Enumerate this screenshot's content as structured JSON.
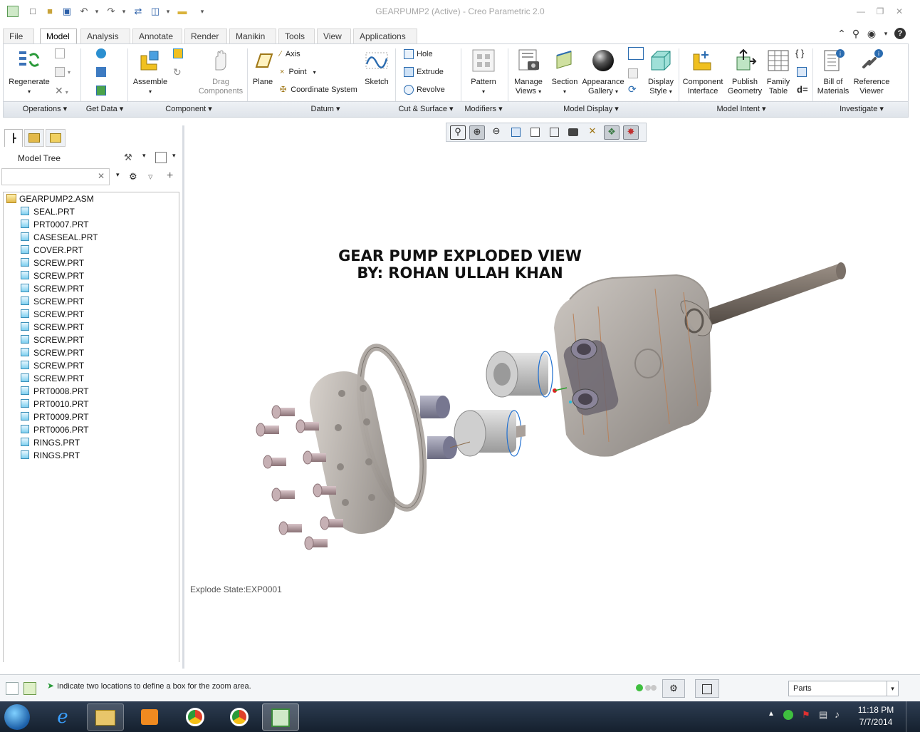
{
  "window": {
    "title": "GEARPUMP2 (Active) - Creo Parametric 2.0"
  },
  "tabs": [
    {
      "label": "File"
    },
    {
      "label": "Model"
    },
    {
      "label": "Analysis"
    },
    {
      "label": "Annotate"
    },
    {
      "label": "Render"
    },
    {
      "label": "Manikin"
    },
    {
      "label": "Tools"
    },
    {
      "label": "View"
    },
    {
      "label": "Applications"
    }
  ],
  "ribbon": {
    "regenerate": "Regenerate",
    "assemble": "Assemble",
    "drag_components_1": "Drag",
    "drag_components_2": "Components",
    "plane": "Plane",
    "axis": "Axis",
    "point": "Point",
    "coordinate_system": "Coordinate System",
    "sketch": "Sketch",
    "hole": "Hole",
    "extrude": "Extrude",
    "revolve": "Revolve",
    "pattern": "Pattern",
    "manage_views_1": "Manage",
    "manage_views_2": "Views",
    "section": "Section",
    "appearance_gallery_1": "Appearance",
    "appearance_gallery_2": "Gallery",
    "display_style_1": "Display",
    "display_style_2": "Style",
    "component_interface_1": "Component",
    "component_interface_2": "Interface",
    "publish_geometry_1": "Publish",
    "publish_geometry_2": "Geometry",
    "family_table_1": "Family",
    "family_table_2": "Table",
    "bill_of_materials_1": "Bill of",
    "bill_of_materials_2": "Materials",
    "reference_viewer_1": "Reference",
    "reference_viewer_2": "Viewer",
    "groups": {
      "operations": "Operations",
      "get_data": "Get Data",
      "component": "Component",
      "datum": "Datum",
      "cut_surface": "Cut & Surface",
      "modifiers": "Modifiers",
      "model_display": "Model Display",
      "model_intent": "Model Intent",
      "investigate": "Investigate"
    }
  },
  "model_tree": {
    "title": "Model Tree",
    "root": "GEARPUMP2.ASM",
    "items": [
      "SEAL.PRT",
      "PRT0007.PRT",
      "CASESEAL.PRT",
      "COVER.PRT",
      "SCREW.PRT",
      "SCREW.PRT",
      "SCREW.PRT",
      "SCREW.PRT",
      "SCREW.PRT",
      "SCREW.PRT",
      "SCREW.PRT",
      "SCREW.PRT",
      "SCREW.PRT",
      "SCREW.PRT",
      "PRT0008.PRT",
      "PRT0010.PRT",
      "PRT0009.PRT",
      "PRT0006.PRT",
      "RINGS.PRT",
      "RINGS.PRT"
    ]
  },
  "canvas": {
    "title_line1": "GEAR PUMP EXPLODED VIEW",
    "title_line2": "BY: ROHAN ULLAH KHAN",
    "explode_state": "Explode State:EXP0001"
  },
  "status": {
    "message": "Indicate two locations to define a box for the zoom area.",
    "filter": "Parts"
  },
  "taskbar": {
    "time": "11:18 PM",
    "date": "7/7/2014"
  },
  "colors": {
    "accent": "#2b6cb0",
    "ribbon_bg": "#ffffff",
    "taskbar": "#1c2838"
  }
}
